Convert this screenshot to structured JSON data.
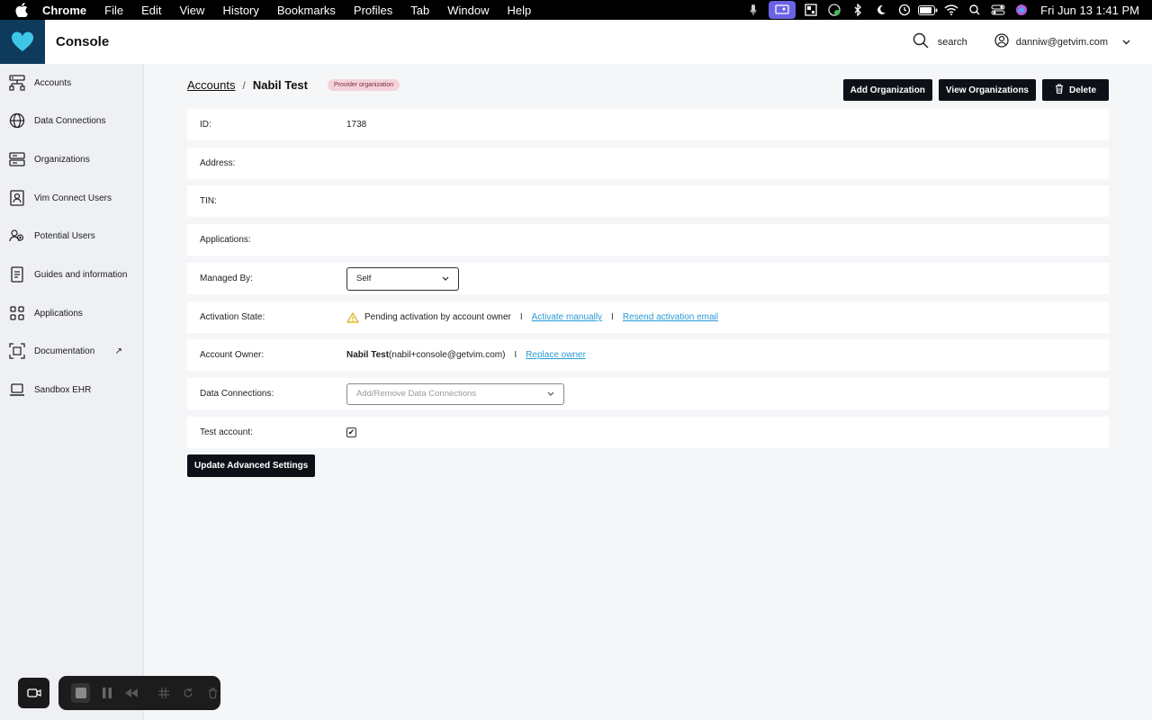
{
  "menubar": {
    "items": [
      "Chrome",
      "File",
      "Edit",
      "View",
      "History",
      "Bookmarks",
      "Profiles",
      "Tab",
      "Window",
      "Help"
    ],
    "clock": "Fri Jun 13  1:41 PM"
  },
  "header": {
    "title": "Console",
    "search_label": "search",
    "user_email": "danniw@getvim.com"
  },
  "sidebar": {
    "items": [
      {
        "label": "Accounts",
        "icon": "accounts-icon"
      },
      {
        "label": "Data Connections",
        "icon": "globe-icon"
      },
      {
        "label": "Organizations",
        "icon": "server-icon"
      },
      {
        "label": "Vim Connect Users",
        "icon": "user-badge-icon"
      },
      {
        "label": "Potential Users",
        "icon": "users-icon"
      },
      {
        "label": "Guides and information",
        "icon": "document-icon"
      },
      {
        "label": "Applications",
        "icon": "grid-icon"
      },
      {
        "label": "Documentation",
        "icon": "scan-icon",
        "external": "↗"
      },
      {
        "label": "Sandbox EHR",
        "icon": "laptop-icon"
      }
    ]
  },
  "breadcrumb": {
    "parent": "Accounts",
    "separator": "/",
    "current": "Nabil Test",
    "badge": "Provider organization"
  },
  "actions": {
    "add_org": "Add Organization",
    "view_orgs": "View Organizations",
    "delete": "Delete"
  },
  "fields": {
    "id": {
      "label": "ID:",
      "value": "1738"
    },
    "address": {
      "label": "Address:"
    },
    "tin": {
      "label": "TIN:"
    },
    "applications": {
      "label": "Applications:"
    },
    "managed_by": {
      "label": "Managed By:",
      "value": "Self"
    },
    "activation_state": {
      "label": "Activation State:",
      "status": "Pending activation by account owner",
      "separator": "I",
      "activate_link": "Activate manually",
      "resend_link": "Resend activation email"
    },
    "account_owner": {
      "label": "Account Owner:",
      "name": "Nabil Test",
      "email": "(nabil+console@getvim.com)",
      "separator": "I",
      "replace_link": "Replace owner"
    },
    "data_connections": {
      "label": "Data Connections:",
      "placeholder": "Add/Remove Data Connections"
    },
    "test_account": {
      "label": "Test account:",
      "checked": true,
      "check_glyph": "✔"
    }
  },
  "update_button": "Update Advanced Settings",
  "colors": {
    "logo_bg": "#0e3a5c",
    "logo_heart": "#3ec6e6",
    "link": "#2a9bd6",
    "badge_bg": "#f6d3dc",
    "warning": "#e0a800"
  }
}
